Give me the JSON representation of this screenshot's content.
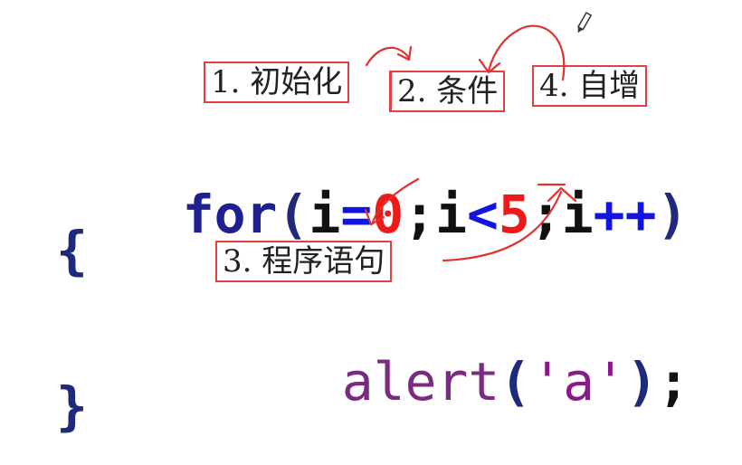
{
  "code": {
    "line1": {
      "keyword": "for",
      "open_paren": "(",
      "init_var": "i",
      "init_op": "=",
      "init_val": "0",
      "sep1": ";",
      "cond_var": "i",
      "cond_op": "<",
      "cond_val": "5",
      "sep2": ";",
      "inc_var": "i",
      "inc_op": "++",
      "close_paren": ")"
    },
    "line2": {
      "brace": "{"
    },
    "line3": {
      "fn": "alert",
      "open_paren": "(",
      "string": "'a'",
      "close_paren": ")",
      "semicolon": ";"
    },
    "line4": {
      "brace": "}"
    }
  },
  "annotations": {
    "init": "1. 初始化",
    "condition": "2. 条件",
    "increment": "4. 自增",
    "body": "3. 程序语句"
  },
  "colors": {
    "keyword": "#1f1f8f",
    "number": "#ee1a1a",
    "operator": "#1414e0",
    "annotation": "#e04040"
  }
}
